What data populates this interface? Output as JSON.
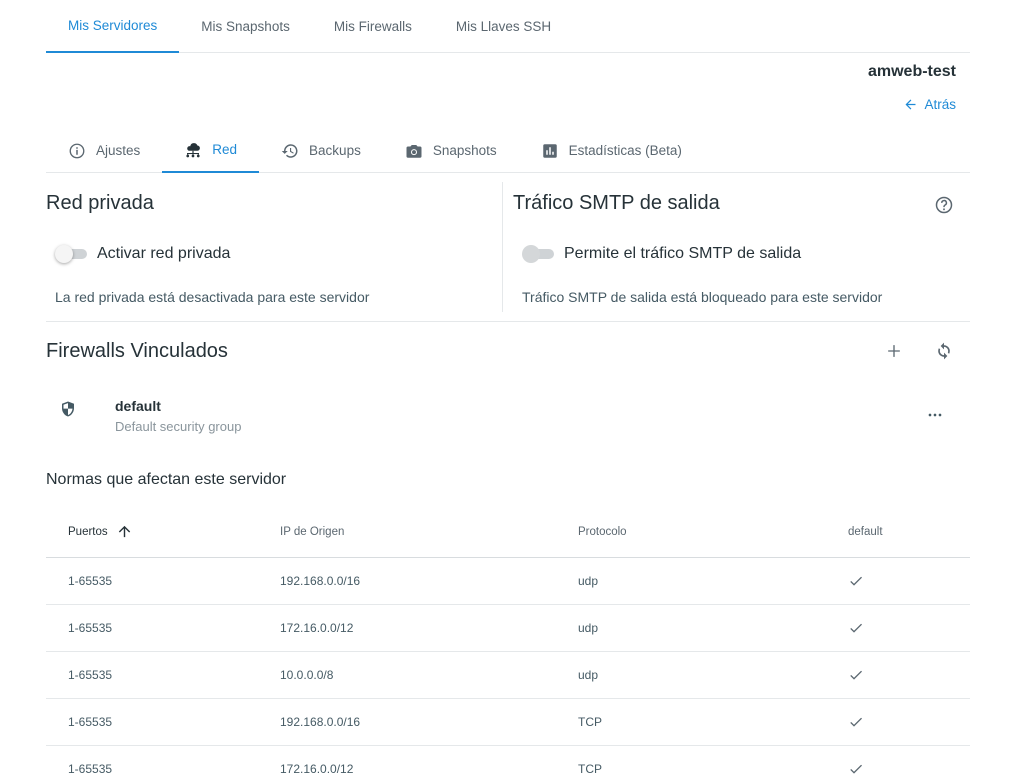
{
  "top_tabs": [
    {
      "label": "Mis Servidores",
      "active": true
    },
    {
      "label": "Mis Snapshots",
      "active": false
    },
    {
      "label": "Mis Firewalls",
      "active": false
    },
    {
      "label": "Mis Llaves SSH",
      "active": false
    }
  ],
  "server": {
    "name": "amweb-test",
    "back_label": "Atrás"
  },
  "sub_tabs": [
    {
      "label": "Ajustes",
      "icon": "info-icon",
      "active": false
    },
    {
      "label": "Red",
      "icon": "cloud-network-icon",
      "active": true
    },
    {
      "label": "Backups",
      "icon": "history-icon",
      "active": false
    },
    {
      "label": "Snapshots",
      "icon": "camera-icon",
      "active": false
    },
    {
      "label": "Estadísticas (Beta)",
      "icon": "bar-chart-icon",
      "active": false
    }
  ],
  "private_network": {
    "title": "Red privada",
    "toggle_label": "Activar red privada",
    "enabled": false,
    "status_text": "La red privada está desactivada para este servidor"
  },
  "smtp": {
    "title": "Tráfico SMTP de salida",
    "toggle_label": "Permite el tráfico SMTP de salida",
    "enabled": false,
    "status_text": "Tráfico SMTP de salida está bloqueado para este servidor"
  },
  "firewalls": {
    "title": "Firewalls Vinculados",
    "items": [
      {
        "name": "default",
        "description": "Default security group"
      }
    ]
  },
  "rules": {
    "title": "Normas que afectan este servidor",
    "columns": [
      "Puertos",
      "IP de Origen",
      "Protocolo",
      "default"
    ],
    "sort_column": "Puertos",
    "sort_direction": "ascending",
    "rows": [
      {
        "ports": "1-65535",
        "source": "192.168.0.0/16",
        "protocol": "udp",
        "default": true
      },
      {
        "ports": "1-65535",
        "source": "172.16.0.0/12",
        "protocol": "udp",
        "default": true
      },
      {
        "ports": "1-65535",
        "source": "10.0.0.0/8",
        "protocol": "udp",
        "default": true
      },
      {
        "ports": "1-65535",
        "source": "192.168.0.0/16",
        "protocol": "TCP",
        "default": true
      },
      {
        "ports": "1-65535",
        "source": "172.16.0.0/12",
        "protocol": "TCP",
        "default": true
      }
    ]
  },
  "colors": {
    "accent": "#1f8ad6",
    "text": "#263238",
    "muted": "#5b6770",
    "divider": "#e5e8ea"
  }
}
